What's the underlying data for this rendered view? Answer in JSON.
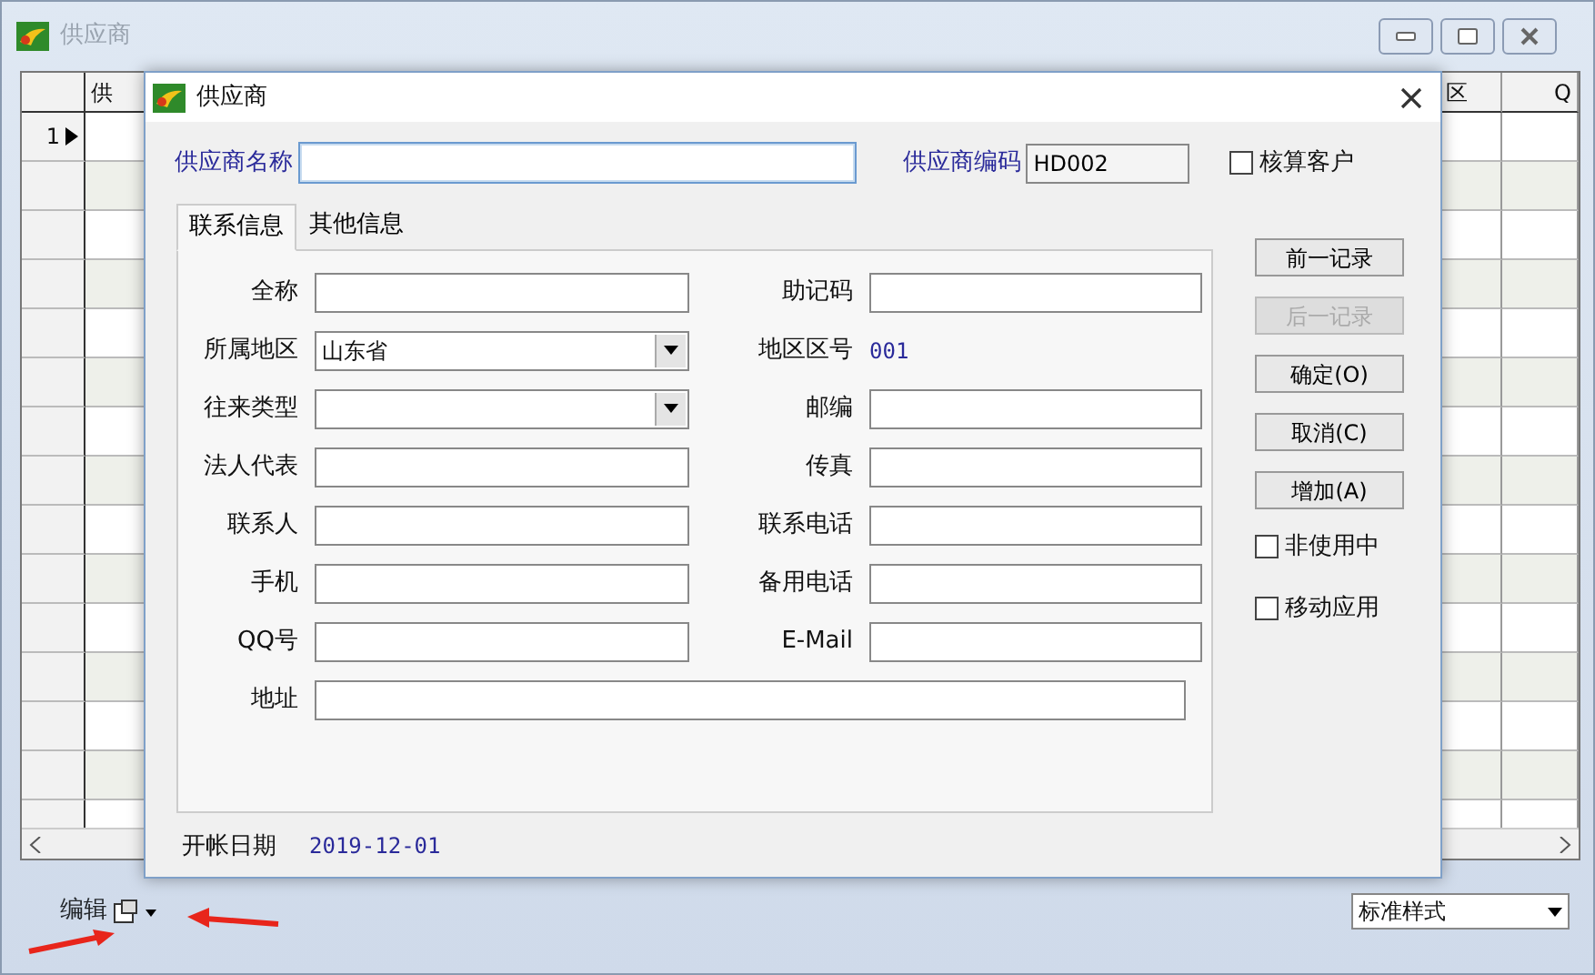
{
  "window": {
    "title": "供应商"
  },
  "grid": {
    "columns": [
      "供",
      "区",
      "Q"
    ],
    "rows": [
      {
        "row_number": "1",
        "current": true
      }
    ]
  },
  "dialog": {
    "title": "供应商",
    "supplier_name": {
      "label": "供应商名称"
    },
    "supplier_code": {
      "label": "供应商编码",
      "value": "HD002"
    },
    "settle_customer": {
      "label": "核算客户",
      "checked": false
    },
    "tabs": [
      {
        "label": "联系信息",
        "selected": true
      },
      {
        "label": "其他信息",
        "selected": false
      }
    ],
    "fields": [
      {
        "label": "全称",
        "kind": "text"
      },
      {
        "label": "助记码",
        "kind": "text"
      },
      {
        "label": "所属地区",
        "kind": "select",
        "value": "山东省"
      },
      {
        "label": "地区区号",
        "kind": "readout",
        "value": "001"
      },
      {
        "label": "往来类型",
        "kind": "select"
      },
      {
        "label": "邮编",
        "kind": "text"
      },
      {
        "label": "法人代表",
        "kind": "text"
      },
      {
        "label": "传真",
        "kind": "text"
      },
      {
        "label": "联系人",
        "kind": "text"
      },
      {
        "label": "联系电话",
        "kind": "text"
      },
      {
        "label": "手机",
        "kind": "text"
      },
      {
        "label": "备用电话",
        "kind": "text"
      },
      {
        "label": "QQ号",
        "kind": "text"
      },
      {
        "label": "E-Mail",
        "kind": "text"
      },
      {
        "label": "地址",
        "kind": "wide"
      }
    ],
    "buttons": [
      {
        "label": "前一记录",
        "disabled": false
      },
      {
        "label": "后一记录",
        "disabled": true
      },
      {
        "label": "确定(O)",
        "disabled": false
      },
      {
        "label": "取消(C)",
        "disabled": false
      },
      {
        "label": "增加(A)",
        "disabled": false
      }
    ],
    "options": [
      {
        "label": "非使用中",
        "checked": false
      },
      {
        "label": "移动应用",
        "checked": false
      }
    ],
    "open_date": {
      "label": "开帐日期",
      "value": "2019-12-01"
    }
  },
  "toolbar": {
    "edit_menu": "编辑",
    "style_select": "标准样式"
  }
}
